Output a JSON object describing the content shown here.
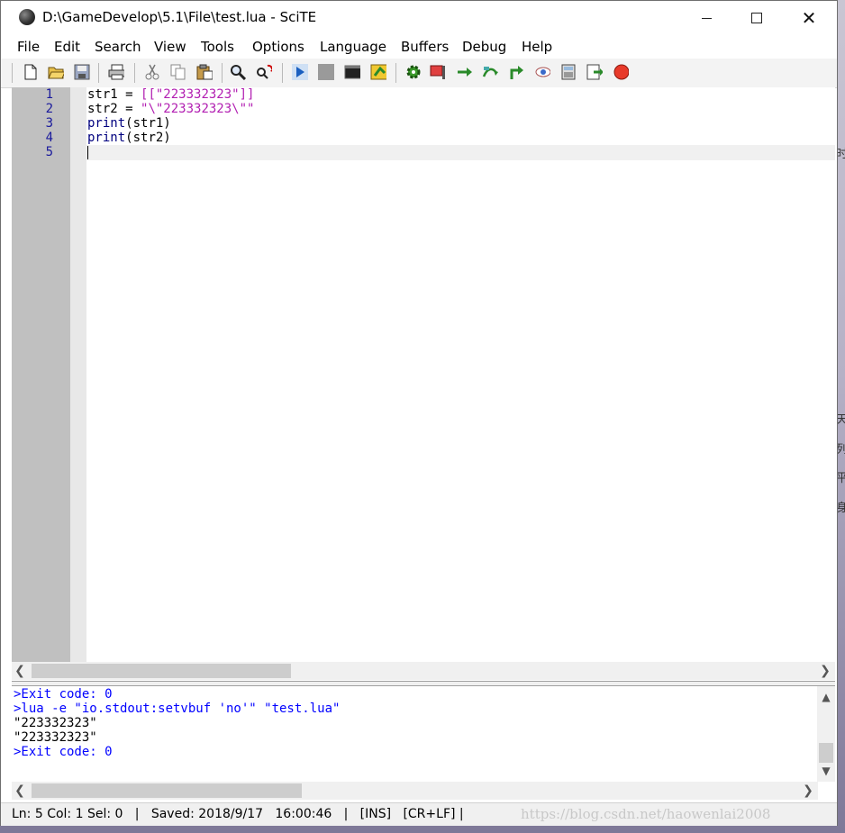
{
  "window": {
    "title": "D:\\GameDevelop\\5.1\\File\\test.lua - SciTE",
    "minimize_icon": "minimize-icon",
    "maximize_icon": "maximize-icon",
    "close_icon": "close-icon",
    "close_glyph": "✕"
  },
  "menubar": {
    "items": [
      "File",
      "Edit",
      "Search",
      "View",
      "Tools",
      "Options",
      "Language",
      "Buffers",
      "Debug",
      "Help"
    ]
  },
  "toolbar": {
    "icons": [
      "new-file-icon",
      "open-folder-icon",
      "save-icon",
      "print-icon",
      "cut-icon",
      "copy-icon",
      "paste-icon",
      "find-icon",
      "replace-icon",
      "run-icon",
      "stop-icon",
      "terminal-icon",
      "build-icon",
      "debug-gear-icon",
      "breakpoint-flag-icon",
      "step-icon",
      "step-over-icon",
      "step-out-icon",
      "watch-icon",
      "calculator-icon",
      "export-icon",
      "record-icon"
    ]
  },
  "editor": {
    "lines": [
      {
        "num": "1",
        "parts": [
          {
            "t": "str1 = ",
            "c": "plain"
          },
          {
            "t": "[[\"223332323\"]]",
            "c": "str"
          }
        ]
      },
      {
        "num": "2",
        "parts": [
          {
            "t": "str2 = ",
            "c": "plain"
          },
          {
            "t": "\"\\\"223332323\\\"\"",
            "c": "str"
          }
        ]
      },
      {
        "num": "3",
        "parts": [
          {
            "t": "print",
            "c": "kw"
          },
          {
            "t": "(str1)",
            "c": "plain"
          }
        ]
      },
      {
        "num": "4",
        "parts": [
          {
            "t": "print",
            "c": "kw"
          },
          {
            "t": "(str2)",
            "c": "plain"
          }
        ]
      },
      {
        "num": "5",
        "parts": []
      }
    ]
  },
  "output": {
    "lines": [
      {
        "text": ">Exit code: 0",
        "style": "cmd"
      },
      {
        "text": ">lua -e \"io.stdout:setvbuf 'no'\" \"test.lua\"",
        "style": "cmd"
      },
      {
        "text": "\"223332323\"",
        "style": "plain"
      },
      {
        "text": "\"223332323\"",
        "style": "plain"
      },
      {
        "text": ">Exit code: 0",
        "style": "cmd"
      }
    ]
  },
  "statusbar": {
    "text": "Ln: 5 Col: 1 Sel: 0   |   Saved: 2018/9/17   16:00:46   |   [INS]   [CR+LF] |"
  },
  "watermark": "https://blog.csdn.net/haowenlai2008",
  "background_text": [
    "时",
    "天",
    "列",
    "平",
    "身"
  ]
}
